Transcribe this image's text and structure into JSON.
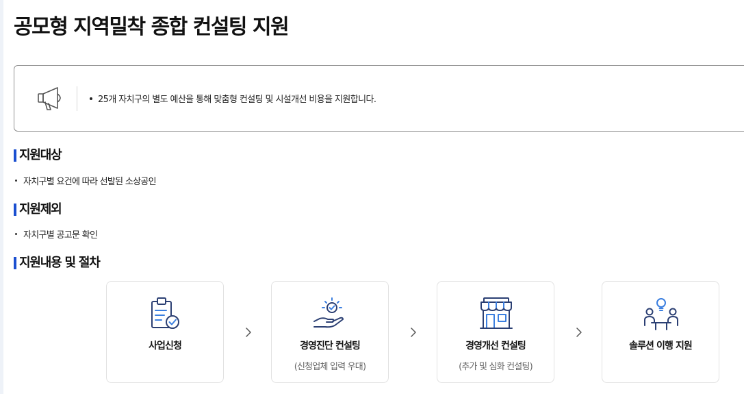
{
  "page": {
    "title": "공모형 지역밀착 종합 컨설팅 지원"
  },
  "notice": {
    "icon": "megaphone-icon",
    "text": "25개 자치구의 별도 예산을 통해 맞춤형 컨설팅 및 시설개선 비용을 지원합니다."
  },
  "sections": {
    "target": {
      "heading": "지원대상",
      "items": [
        "자치구별 요건에 따라 선발된 소상공인"
      ]
    },
    "exclusion": {
      "heading": "지원제외",
      "items": [
        "자치구별 공고문 확인"
      ]
    },
    "procedure": {
      "heading": "지원내용 및 절차"
    }
  },
  "steps": [
    {
      "icon": "clipboard-check-icon",
      "title": "사업신청",
      "subtitle": ""
    },
    {
      "icon": "hand-lightbulb-icon",
      "title": "경영진단 컨설팅",
      "subtitle": "(신청업체 입력 우대)"
    },
    {
      "icon": "storefront-icon",
      "title": "경영개선 컨설팅",
      "subtitle": "(추가 및 심화 컨설팅)"
    },
    {
      "icon": "meeting-idea-icon",
      "title": "솔루션 이행 지원",
      "subtitle": ""
    }
  ],
  "colors": {
    "accent": "#1b4fd0",
    "icon_navy": "#2b3f73",
    "icon_blue": "#3b7fe0"
  }
}
